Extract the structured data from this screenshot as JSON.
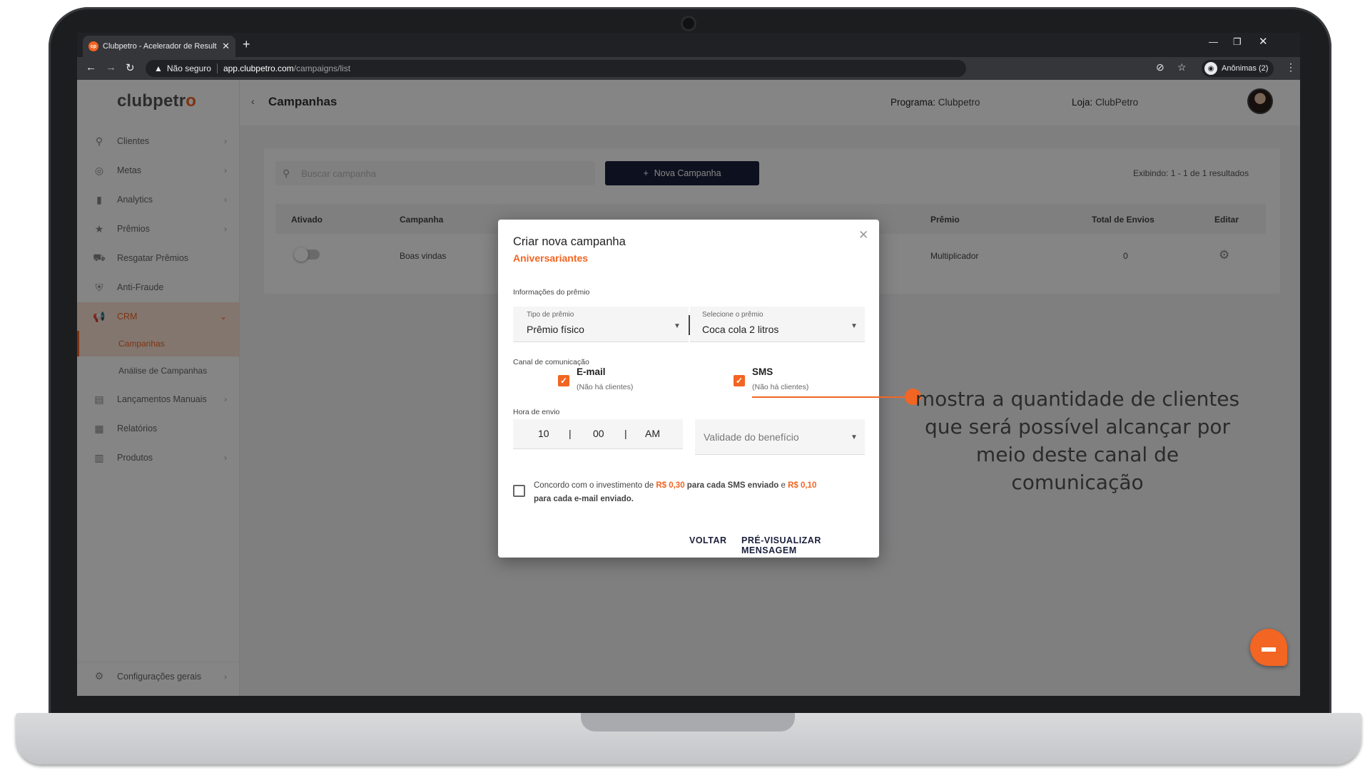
{
  "browser": {
    "tab_title": "Clubpetro - Acelerador de Result",
    "tab_close": "✕",
    "new_tab": "+",
    "favicon": "cp",
    "not_secure": "Não seguro",
    "url_host": "app.clubpetro.com",
    "url_path": "/campaigns/list",
    "incognito_label": "Anônimas (2)",
    "icons": {
      "back": "back-arrow-icon",
      "forward": "forward-arrow-icon",
      "reload": "reload-icon",
      "star": "star-icon"
    }
  },
  "sidebar": {
    "logo_main": "clubpetr",
    "logo_accent": "o",
    "items": [
      {
        "label": "Clientes",
        "icon": "person-icon",
        "glyph": "⚲",
        "chev": "›"
      },
      {
        "label": "Metas",
        "icon": "target-icon",
        "glyph": "◎",
        "chev": "›"
      },
      {
        "label": "Analytics",
        "icon": "bar-chart-icon",
        "glyph": "▮",
        "chev": "›"
      },
      {
        "label": "Prêmios",
        "icon": "star-icon",
        "glyph": "★",
        "chev": "›"
      },
      {
        "label": "Resgatar Prêmios",
        "icon": "cart-icon",
        "glyph": "⛟",
        "chev": ""
      },
      {
        "label": "Anti-Fraude",
        "icon": "shield-icon",
        "glyph": "⛨",
        "chev": ""
      },
      {
        "label": "CRM",
        "icon": "megaphone-icon",
        "glyph": "📢",
        "chev": "⌄"
      },
      {
        "label": "Lançamentos Manuais",
        "icon": "document-icon",
        "glyph": "▤",
        "chev": "›"
      },
      {
        "label": "Relatórios",
        "icon": "clipboard-icon",
        "glyph": "▦",
        "chev": ""
      },
      {
        "label": "Produtos",
        "icon": "products-icon",
        "glyph": "▥",
        "chev": "›"
      }
    ],
    "sub_items": [
      "Campanhas",
      "Análise de Campanhas"
    ],
    "settings": {
      "label": "Configurações gerais",
      "icon": "gear-icon",
      "glyph": "⚙",
      "chev": "›"
    }
  },
  "header": {
    "back": "‹",
    "title": "Campanhas",
    "program_label": "Programa:",
    "program_value": "Clubpetro",
    "store_label": "Loja:",
    "store_value": "ClubPetro"
  },
  "list": {
    "search_placeholder": "Buscar campanha",
    "new_button": "Nova Campanha",
    "results": "Exibindo: 1 - 1 de 1 resultados",
    "columns": [
      "Ativado",
      "Campanha",
      "Prêmio",
      "Total de Envios",
      "Editar"
    ],
    "rows": [
      {
        "campaign": "Boas vindas",
        "prize": "Multiplicador",
        "total": "0",
        "active": false
      }
    ]
  },
  "modal": {
    "title": "Criar nova campanha",
    "subtitle": "Aniversariantes",
    "prize_section": "Informações do prêmio",
    "prize_type_label": "Tipo de prêmio",
    "prize_type_value": "Prêmio físico",
    "prize_select_label": "Selecione o prêmio",
    "prize_select_value": "Coca cola 2 litros",
    "channel_section": "Canal de comunicação",
    "channels": [
      {
        "name": "E-mail",
        "note": "(Não há clientes)",
        "checked": true
      },
      {
        "name": "SMS",
        "note": "(Não há clientes)",
        "checked": true
      }
    ],
    "time_section": "Hora de envio",
    "hour": "10",
    "minute": "00",
    "ampm": "AM",
    "validity_placeholder": "Validade do benefício",
    "agree_1": "Concordo com o investimento de ",
    "agree_price_sms": "R$ 0,30",
    "agree_2": " para cada SMS enviado",
    "agree_3": " e ",
    "agree_price_email": "R$ 0,10",
    "agree_4": "para cada e-mail enviado.",
    "back_button": "VOLTAR",
    "preview_button": "PRÉ-VISUALIZAR MENSAGEM"
  },
  "annotation": {
    "line1": "mostra a quantidade de clientes",
    "line2": "que será possível alcançar por",
    "line3": "meio deste canal de comunicação"
  },
  "colors": {
    "accent": "#f26522",
    "primary_dark": "#1a1f3b"
  }
}
